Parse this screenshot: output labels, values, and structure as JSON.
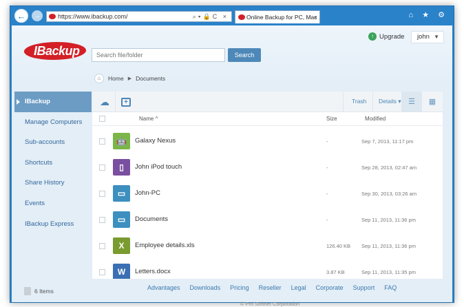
{
  "browser": {
    "url": "https://www.ibackup.com/",
    "tab_title": "Online Backup for PC, Mac ...",
    "tab_close": "×",
    "chrome_icons": "⌂ ★ ⚙",
    "address_tools": "⌕▾🔒C ×"
  },
  "header": {
    "brand": "IBackup",
    "search_placeholder": "Search file/folder",
    "search_button": "Search",
    "upgrade_label": "Upgrade",
    "user_name": "john"
  },
  "breadcrumb": {
    "home": "Home",
    "current": "Documents"
  },
  "sidebar": {
    "items": [
      {
        "label": "IBackup"
      },
      {
        "label": "Manage Computers"
      },
      {
        "label": "Sub-accounts"
      },
      {
        "label": "Shortcuts"
      },
      {
        "label": "Share History"
      },
      {
        "label": "Events"
      },
      {
        "label": "IBackup Express"
      }
    ],
    "items_count": "6 Items"
  },
  "toolbar": {
    "trash": "Trash",
    "details": "Details ▾"
  },
  "columns": {
    "name": "Name ^",
    "size": "Size",
    "modified": "Modified"
  },
  "files": [
    {
      "name": "Galaxy Nexus",
      "size": "-",
      "modified": "Sep 7, 2013, 11:17 pm",
      "icon": "android-icon",
      "color": "#7ab648"
    },
    {
      "name": "John iPod touch",
      "size": "-",
      "modified": "Sep 28, 2013, 02:47 am",
      "icon": "ipod-icon",
      "color": "#7b4fa0"
    },
    {
      "name": "John-PC",
      "size": "-",
      "modified": "Sep 30, 2013, 03:26 am",
      "icon": "folder-icon",
      "color": "#3d8fbf"
    },
    {
      "name": "Documents",
      "size": "-",
      "modified": "Sep 11, 2013, 11:36 pm",
      "icon": "folder-icon",
      "color": "#3d8fbf"
    },
    {
      "name": "Employee details.xls",
      "size": "126.40 KB",
      "modified": "Sep 11, 2013, 11:36 pm",
      "icon": "excel-icon",
      "color": "#7a9b2f"
    },
    {
      "name": "Letters.docx",
      "size": "3.87 KB",
      "modified": "Sep 11, 2013, 11:35 pm",
      "icon": "word-icon",
      "color": "#3b6fb3"
    }
  ],
  "footer": {
    "links": [
      "Advantages",
      "Downloads",
      "Pricing",
      "Reseller",
      "Legal",
      "Corporate",
      "Support",
      "FAQ"
    ],
    "copyright": "© Pro Softnet Corporation"
  }
}
